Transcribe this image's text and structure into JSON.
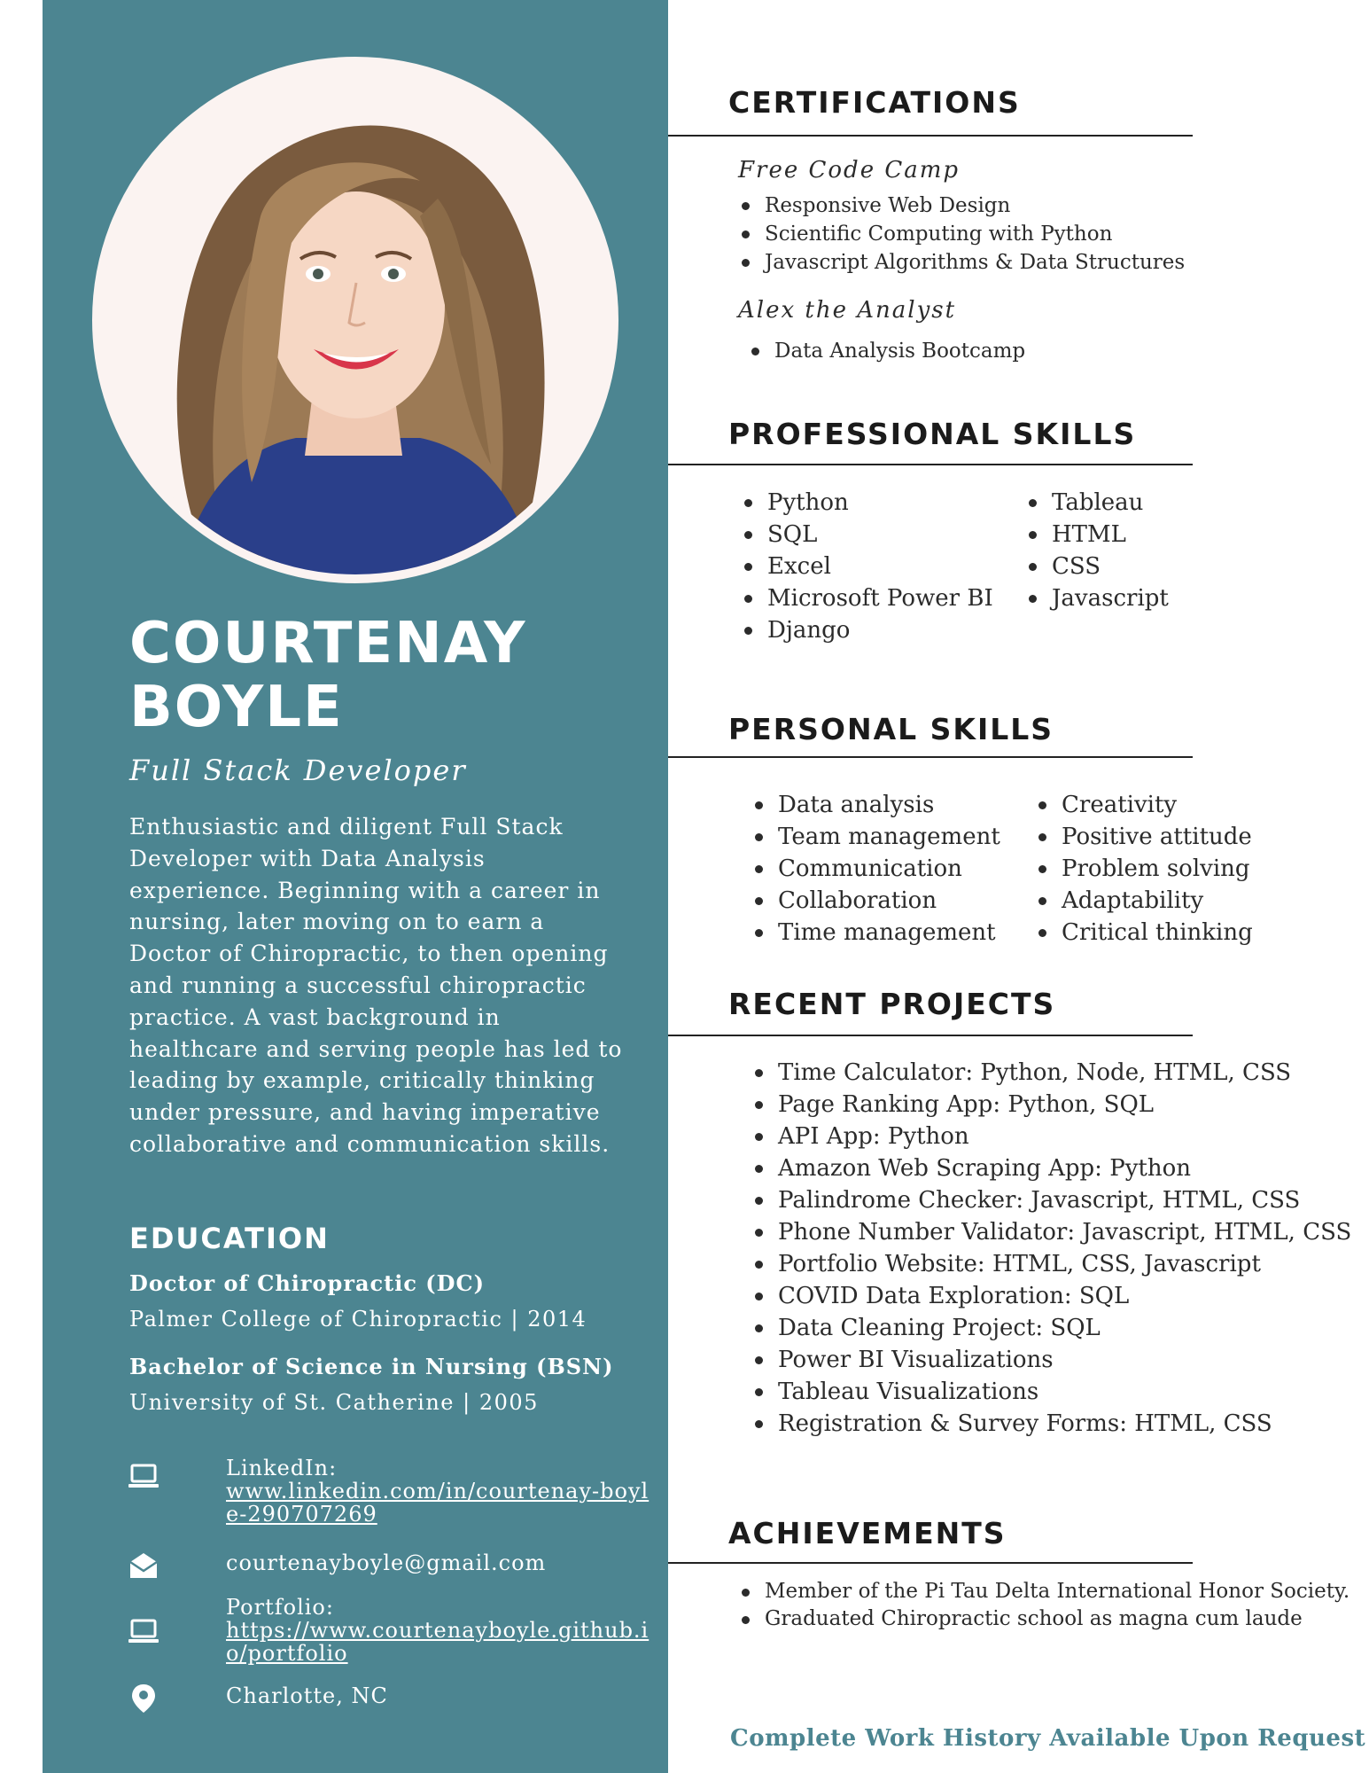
{
  "colors": {
    "sidebar": "#4c8591",
    "accent": "#4c8591",
    "text": "#2b2b2b"
  },
  "profile": {
    "first_name": "COURTENAY",
    "last_name": "BOYLE",
    "title": "Full Stack Developer",
    "summary": "Enthusiastic and diligent Full Stack Developer with Data Analysis experience. Beginning with a career in nursing, later moving on to earn a Doctor of Chiropractic, to then opening and running a successful chiropractic practice. A vast background in healthcare and serving people has led to leading by example, critically thinking under pressure, and having imperative collaborative and communication skills."
  },
  "education": {
    "heading": "EDUCATION",
    "entries": [
      {
        "degree": "Doctor of Chiropractic (DC)",
        "school": "Palmer College of Chiropractic | 2014"
      },
      {
        "degree": "Bachelor of Science in Nursing (BSN)",
        "school": "University of St. Catherine | 2005"
      }
    ]
  },
  "contact": {
    "linkedin_label": "LinkedIn:",
    "linkedin_url": "www.linkedin.com/in/courtenay-boyle-290707269",
    "email": "courtenayboyle@gmail.com",
    "portfolio_label": "Portfolio:",
    "portfolio_url": "https://www.courtenayboyle.github.io/portfolio",
    "location": "Charlotte, NC",
    "icons": [
      "laptop-icon",
      "envelope-open-icon",
      "laptop-icon",
      "location-pin-icon"
    ]
  },
  "certifications": {
    "heading": "CERTIFICATIONS",
    "groups": [
      {
        "org": "Free Code Camp",
        "items": [
          "Responsive Web Design",
          "Scientific Computing with Python",
          "Javascript Algorithms & Data Structures"
        ]
      },
      {
        "org": "Alex the Analyst",
        "items": [
          "Data Analysis Bootcamp"
        ]
      }
    ]
  },
  "professional_skills": {
    "heading": "PROFESSIONAL SKILLS",
    "left": [
      "Python",
      "SQL",
      "Excel",
      "Microsoft Power BI",
      "Django"
    ],
    "right": [
      "Tableau",
      "HTML",
      "CSS",
      "Javascript"
    ]
  },
  "personal_skills": {
    "heading": "PERSONAL SKILLS",
    "left": [
      "Data analysis",
      "Team management",
      "Communication",
      "Collaboration",
      "Time management"
    ],
    "right": [
      "Creativity",
      "Positive attitude",
      "Problem solving",
      "Adaptability",
      "Critical thinking"
    ]
  },
  "projects": {
    "heading": "RECENT PROJECTS",
    "items": [
      "Time Calculator: Python, Node, HTML, CSS",
      "Page Ranking App: Python, SQL",
      "API App: Python",
      "Amazon Web Scraping App: Python",
      "Palindrome Checker: Javascript, HTML, CSS",
      "Phone Number Validator: Javascript, HTML, CSS",
      "Portfolio Website: HTML, CSS, Javascript",
      "COVID Data Exploration: SQL",
      "Data Cleaning Project: SQL",
      "Power BI Visualizations",
      "Tableau Visualizations",
      "Registration & Survey Forms: HTML, CSS"
    ]
  },
  "achievements": {
    "heading": "ACHIEVEMENTS",
    "items": [
      "Member of the Pi Tau Delta International Honor Society.",
      "Graduated Chiropractic school as magna cum laude"
    ]
  },
  "footer": {
    "note": "Complete Work History Available Upon Request"
  }
}
